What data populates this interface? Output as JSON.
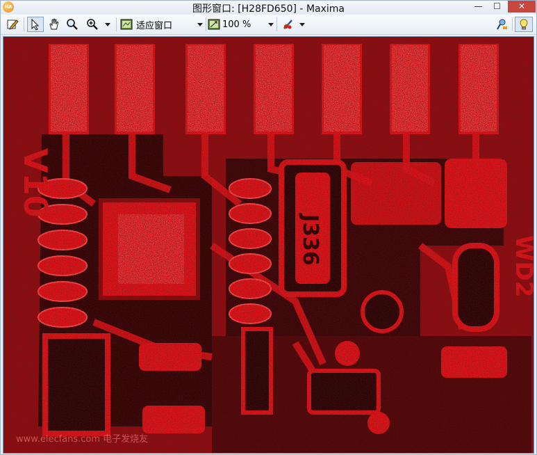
{
  "window": {
    "title": "图形窗口: [H28FD650] - Maxima",
    "app_icon_text": "HA",
    "minimize_glyph": "—",
    "maximize_glyph": "☐",
    "close_glyph": "✕"
  },
  "toolbar": {
    "fit_window_label": "适应窗口",
    "zoom_value": "100 %"
  },
  "image": {
    "board_marks": [
      "V10",
      "J336",
      "WD2"
    ],
    "watermark": "www.elecfans.com 电子发烧友"
  },
  "colors": {
    "pcb_red": "#e0141a",
    "pcb_dark": "#140405",
    "speckle_white": "#f3e9e9"
  }
}
